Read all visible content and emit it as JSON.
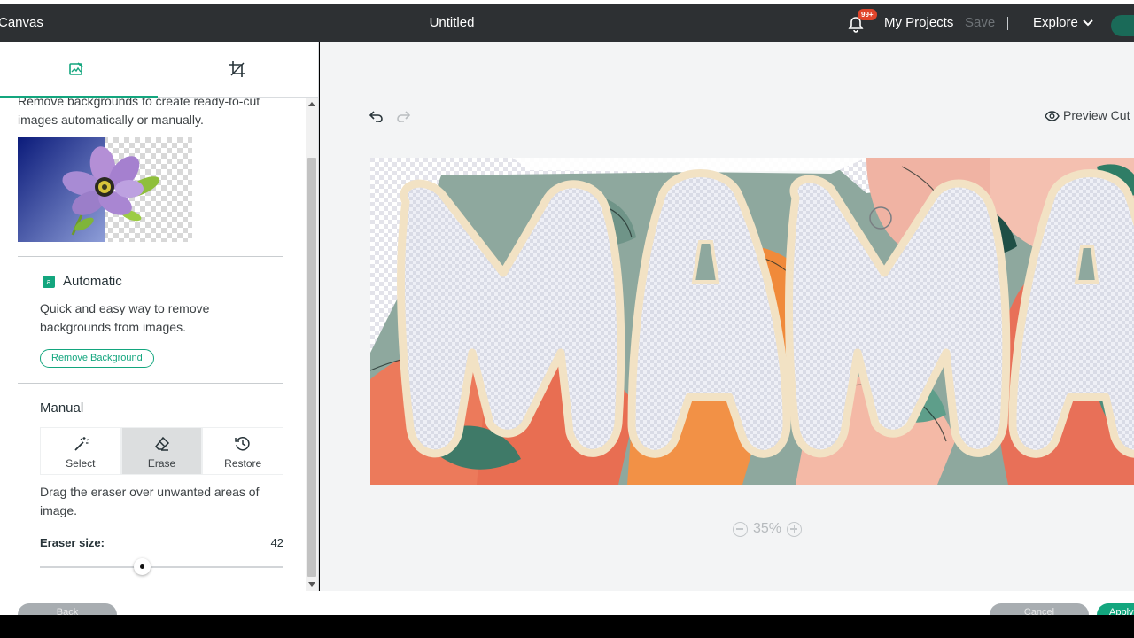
{
  "header": {
    "app_name": "Canvas",
    "doc_title": "Untitled",
    "notifications_badge": "99+",
    "my_projects": "My Projects",
    "save": "Save",
    "explore": "Explore"
  },
  "panel": {
    "intro": "Remove backgrounds to create ready-to-cut images automatically or manually.",
    "automatic": {
      "title": "Automatic",
      "icon_letter": "a",
      "description": "Quick and easy way to remove backgrounds from images.",
      "button": "Remove Background"
    },
    "manual": {
      "title": "Manual",
      "tools": [
        {
          "label": "Select",
          "icon": "magic-wand-icon",
          "active": false
        },
        {
          "label": "Erase",
          "icon": "eraser-icon",
          "active": true
        },
        {
          "label": "Restore",
          "icon": "restore-icon",
          "active": false
        }
      ],
      "description": "Drag the eraser over unwanted areas of image.",
      "eraser_size_label": "Eraser size:",
      "eraser_size_value": "42"
    }
  },
  "canvas": {
    "preview_cut": "Preview Cut",
    "zoom": "35%"
  },
  "footer": {
    "back": "Back",
    "cancel": "Cancel",
    "apply": "Apply"
  },
  "colors": {
    "accent": "#13a67e",
    "topbar": "#2d3033"
  }
}
